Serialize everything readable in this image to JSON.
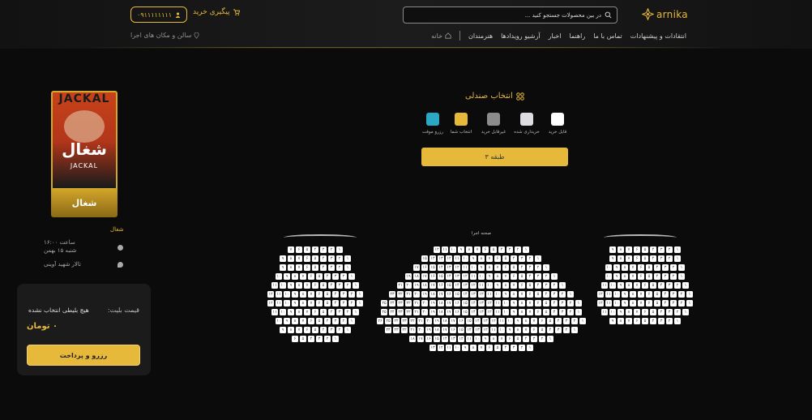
{
  "header": {
    "phone": "۰۹۱۱۱۱۱۱۱۱",
    "track_order": "پیگیری خرید",
    "search_placeholder": "در بین محصولات جستجو کنید ...",
    "logo_text": "arnika",
    "nav": [
      "خانه",
      "هنرمندان",
      "آرشیو رویدادها",
      "اخبار",
      "راهنما",
      "تماس با ما",
      "انتقادات و پیشنهادات"
    ],
    "venues_link": "سالن و مکان های اجرا"
  },
  "show": {
    "poster_top_text": "JACKAL",
    "poster_title": "شغال",
    "poster_subtitle": "JACKAL",
    "label": "شغال",
    "name": "شغال",
    "time": "ساعت ۱۶:۰۰",
    "date": "شنبه ۱۵ بهمن",
    "venue": "تالار شهید آوینی"
  },
  "payment": {
    "price_label": "قیمت بلیت:",
    "no_seat": "هیچ بلیطی انتخاب نشده",
    "amount": "۰ تومان",
    "button": "رزرو و پرداخت"
  },
  "seat_selection": {
    "title": "انتخاب صندلی",
    "legend": [
      {
        "label": "قابل خرید",
        "color": "#ffffff"
      },
      {
        "label": "خریداری شده",
        "color": "#dcdce2"
      },
      {
        "label": "غیرقابل خرید",
        "color": "#8c8c8c"
      },
      {
        "label": "انتخاب شما",
        "color": "#e6b93a"
      },
      {
        "label": "رزرو موقت",
        "color": "#2aa8c4"
      }
    ],
    "floor": "طبقه ۳",
    "stage": "صحنه اجرا"
  },
  "colors": {
    "accent": "#e6b93a",
    "background": "#0b0b0b",
    "panel": "#1b1b1b"
  }
}
